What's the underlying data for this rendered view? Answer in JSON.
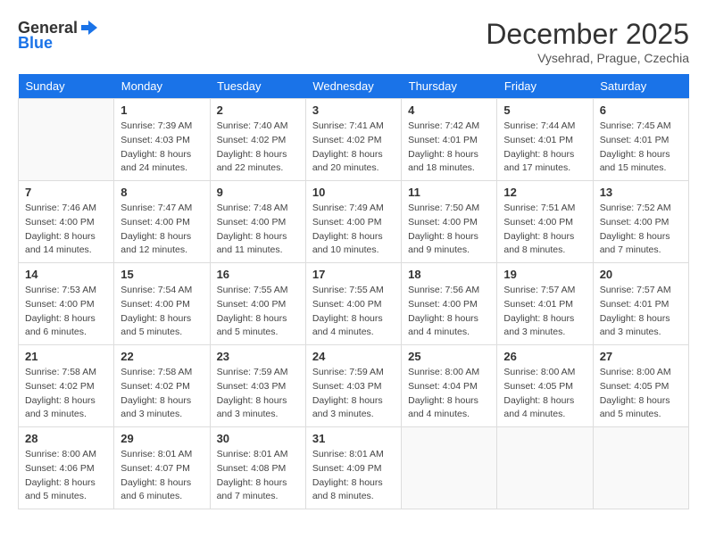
{
  "header": {
    "logo_line1": "General",
    "logo_line2": "Blue",
    "month": "December 2025",
    "location": "Vysehrad, Prague, Czechia"
  },
  "weekdays": [
    "Sunday",
    "Monday",
    "Tuesday",
    "Wednesday",
    "Thursday",
    "Friday",
    "Saturday"
  ],
  "weeks": [
    [
      {
        "day": "",
        "detail": ""
      },
      {
        "day": "1",
        "detail": "Sunrise: 7:39 AM\nSunset: 4:03 PM\nDaylight: 8 hours\nand 24 minutes."
      },
      {
        "day": "2",
        "detail": "Sunrise: 7:40 AM\nSunset: 4:02 PM\nDaylight: 8 hours\nand 22 minutes."
      },
      {
        "day": "3",
        "detail": "Sunrise: 7:41 AM\nSunset: 4:02 PM\nDaylight: 8 hours\nand 20 minutes."
      },
      {
        "day": "4",
        "detail": "Sunrise: 7:42 AM\nSunset: 4:01 PM\nDaylight: 8 hours\nand 18 minutes."
      },
      {
        "day": "5",
        "detail": "Sunrise: 7:44 AM\nSunset: 4:01 PM\nDaylight: 8 hours\nand 17 minutes."
      },
      {
        "day": "6",
        "detail": "Sunrise: 7:45 AM\nSunset: 4:01 PM\nDaylight: 8 hours\nand 15 minutes."
      }
    ],
    [
      {
        "day": "7",
        "detail": "Sunrise: 7:46 AM\nSunset: 4:00 PM\nDaylight: 8 hours\nand 14 minutes."
      },
      {
        "day": "8",
        "detail": "Sunrise: 7:47 AM\nSunset: 4:00 PM\nDaylight: 8 hours\nand 12 minutes."
      },
      {
        "day": "9",
        "detail": "Sunrise: 7:48 AM\nSunset: 4:00 PM\nDaylight: 8 hours\nand 11 minutes."
      },
      {
        "day": "10",
        "detail": "Sunrise: 7:49 AM\nSunset: 4:00 PM\nDaylight: 8 hours\nand 10 minutes."
      },
      {
        "day": "11",
        "detail": "Sunrise: 7:50 AM\nSunset: 4:00 PM\nDaylight: 8 hours\nand 9 minutes."
      },
      {
        "day": "12",
        "detail": "Sunrise: 7:51 AM\nSunset: 4:00 PM\nDaylight: 8 hours\nand 8 minutes."
      },
      {
        "day": "13",
        "detail": "Sunrise: 7:52 AM\nSunset: 4:00 PM\nDaylight: 8 hours\nand 7 minutes."
      }
    ],
    [
      {
        "day": "14",
        "detail": "Sunrise: 7:53 AM\nSunset: 4:00 PM\nDaylight: 8 hours\nand 6 minutes."
      },
      {
        "day": "15",
        "detail": "Sunrise: 7:54 AM\nSunset: 4:00 PM\nDaylight: 8 hours\nand 5 minutes."
      },
      {
        "day": "16",
        "detail": "Sunrise: 7:55 AM\nSunset: 4:00 PM\nDaylight: 8 hours\nand 5 minutes."
      },
      {
        "day": "17",
        "detail": "Sunrise: 7:55 AM\nSunset: 4:00 PM\nDaylight: 8 hours\nand 4 minutes."
      },
      {
        "day": "18",
        "detail": "Sunrise: 7:56 AM\nSunset: 4:00 PM\nDaylight: 8 hours\nand 4 minutes."
      },
      {
        "day": "19",
        "detail": "Sunrise: 7:57 AM\nSunset: 4:01 PM\nDaylight: 8 hours\nand 3 minutes."
      },
      {
        "day": "20",
        "detail": "Sunrise: 7:57 AM\nSunset: 4:01 PM\nDaylight: 8 hours\nand 3 minutes."
      }
    ],
    [
      {
        "day": "21",
        "detail": "Sunrise: 7:58 AM\nSunset: 4:02 PM\nDaylight: 8 hours\nand 3 minutes."
      },
      {
        "day": "22",
        "detail": "Sunrise: 7:58 AM\nSunset: 4:02 PM\nDaylight: 8 hours\nand 3 minutes."
      },
      {
        "day": "23",
        "detail": "Sunrise: 7:59 AM\nSunset: 4:03 PM\nDaylight: 8 hours\nand 3 minutes."
      },
      {
        "day": "24",
        "detail": "Sunrise: 7:59 AM\nSunset: 4:03 PM\nDaylight: 8 hours\nand 3 minutes."
      },
      {
        "day": "25",
        "detail": "Sunrise: 8:00 AM\nSunset: 4:04 PM\nDaylight: 8 hours\nand 4 minutes."
      },
      {
        "day": "26",
        "detail": "Sunrise: 8:00 AM\nSunset: 4:05 PM\nDaylight: 8 hours\nand 4 minutes."
      },
      {
        "day": "27",
        "detail": "Sunrise: 8:00 AM\nSunset: 4:05 PM\nDaylight: 8 hours\nand 5 minutes."
      }
    ],
    [
      {
        "day": "28",
        "detail": "Sunrise: 8:00 AM\nSunset: 4:06 PM\nDaylight: 8 hours\nand 5 minutes."
      },
      {
        "day": "29",
        "detail": "Sunrise: 8:01 AM\nSunset: 4:07 PM\nDaylight: 8 hours\nand 6 minutes."
      },
      {
        "day": "30",
        "detail": "Sunrise: 8:01 AM\nSunset: 4:08 PM\nDaylight: 8 hours\nand 7 minutes."
      },
      {
        "day": "31",
        "detail": "Sunrise: 8:01 AM\nSunset: 4:09 PM\nDaylight: 8 hours\nand 8 minutes."
      },
      {
        "day": "",
        "detail": ""
      },
      {
        "day": "",
        "detail": ""
      },
      {
        "day": "",
        "detail": ""
      }
    ]
  ]
}
